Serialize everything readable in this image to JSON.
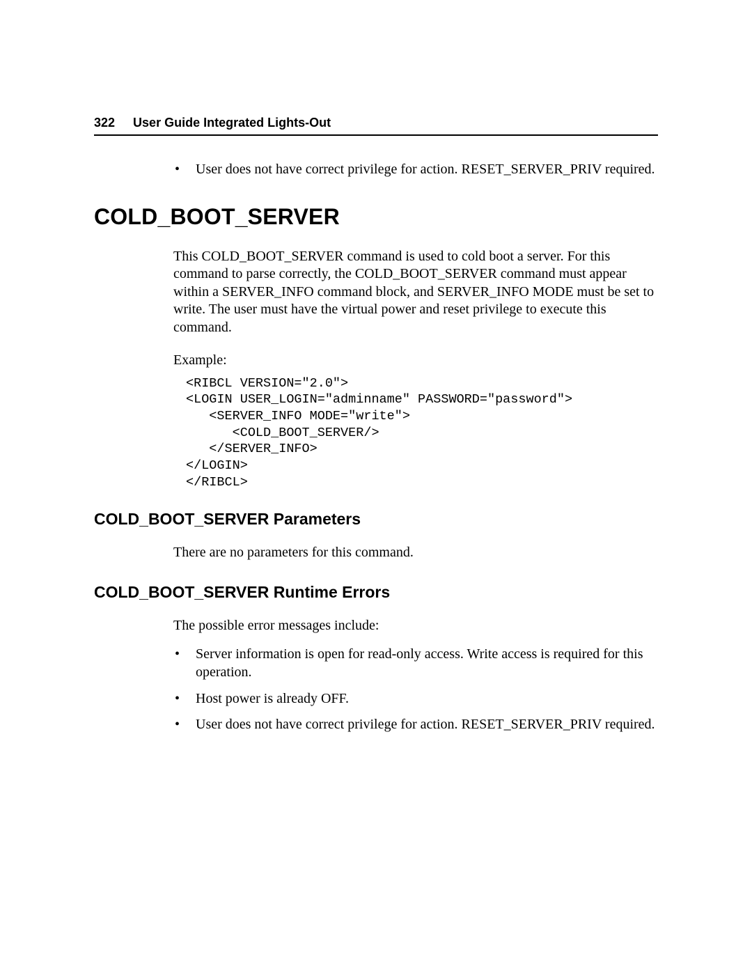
{
  "header": {
    "page_number": "322",
    "title": "User Guide Integrated Lights-Out"
  },
  "intro_bullets": [
    "User does not have correct privilege for action. RESET_SERVER_PRIV required."
  ],
  "section": {
    "title": "COLD_BOOT_SERVER",
    "description": "This COLD_BOOT_SERVER command is used to cold boot a server. For this command to parse correctly, the COLD_BOOT_SERVER command must appear within a SERVER_INFO command block, and SERVER_INFO MODE must be set to write. The user must have the virtual power and reset privilege to execute this command.",
    "example_label": "Example:",
    "code": "<RIBCL VERSION=\"2.0\">\n<LOGIN USER_LOGIN=\"adminname\" PASSWORD=\"password\">\n   <SERVER_INFO MODE=\"write\">\n      <COLD_BOOT_SERVER/>\n   </SERVER_INFO>\n</LOGIN>\n</RIBCL>"
  },
  "parameters_section": {
    "title": "COLD_BOOT_SERVER Parameters",
    "text": "There are no parameters for this command."
  },
  "errors_section": {
    "title": "COLD_BOOT_SERVER Runtime Errors",
    "intro": "The possible error messages include:",
    "items": [
      "Server information is open for read-only access. Write access is required for this operation.",
      "Host power is already OFF.",
      "User does not have correct privilege for action. RESET_SERVER_PRIV required."
    ]
  }
}
